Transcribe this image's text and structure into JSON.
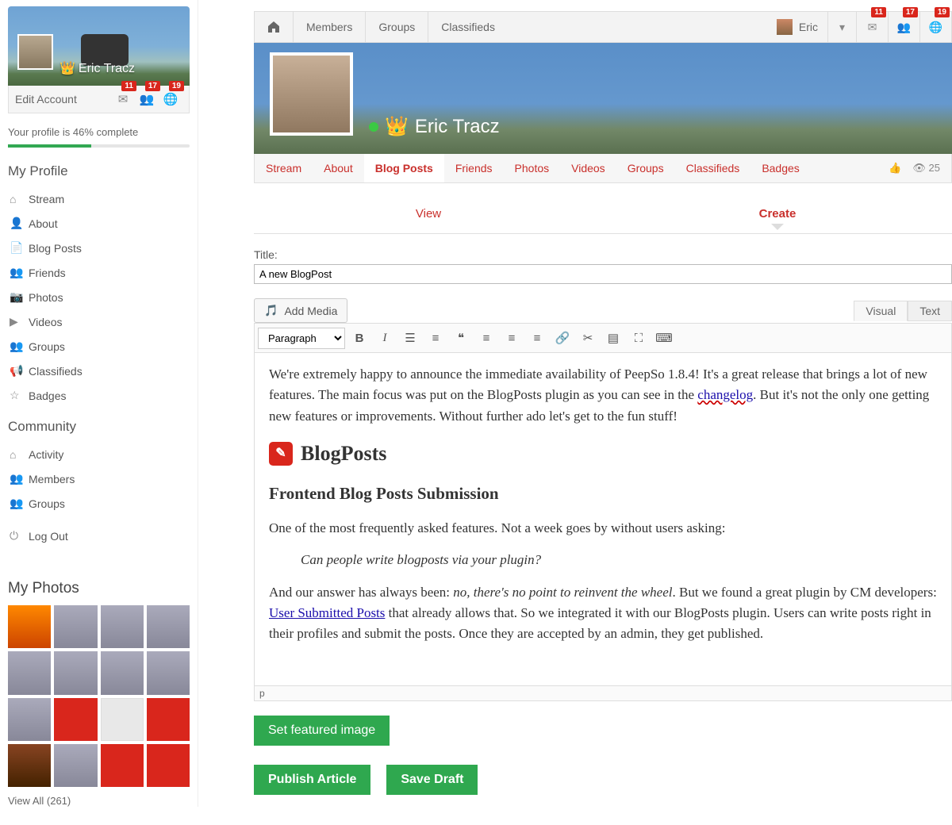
{
  "user": {
    "name": "Eric Tracz",
    "edit_label": "Edit Account"
  },
  "sidebar_badges": {
    "mail": "11",
    "friends": "17",
    "globe": "19"
  },
  "profile_progress": {
    "text": "Your profile is 46% complete",
    "percent": 46
  },
  "sections": {
    "my_profile": "My Profile",
    "community": "Community",
    "my_photos": "My Photos"
  },
  "nav_profile": [
    {
      "label": "Stream",
      "icon": "home"
    },
    {
      "label": "About",
      "icon": "user"
    },
    {
      "label": "Blog Posts",
      "icon": "file"
    },
    {
      "label": "Friends",
      "icon": "people"
    },
    {
      "label": "Photos",
      "icon": "camera"
    },
    {
      "label": "Videos",
      "icon": "play"
    },
    {
      "label": "Groups",
      "icon": "group"
    },
    {
      "label": "Classifieds",
      "icon": "bullhorn"
    },
    {
      "label": "Badges",
      "icon": "star"
    }
  ],
  "nav_community": [
    {
      "label": "Activity",
      "icon": "home"
    },
    {
      "label": "Members",
      "icon": "people"
    },
    {
      "label": "Groups",
      "icon": "group"
    }
  ],
  "logout": "Log Out",
  "view_all": "View All (261)",
  "topnav": {
    "members": "Members",
    "groups": "Groups",
    "classifieds": "Classifieds",
    "username": "Eric"
  },
  "top_badges": {
    "mail": "11",
    "friends": "17",
    "globe": "19"
  },
  "profile_tabs": [
    "Stream",
    "About",
    "Blog Posts",
    "Friends",
    "Photos",
    "Videos",
    "Groups",
    "Classifieds",
    "Badges"
  ],
  "profile_tabs_active": "Blog Posts",
  "views": "25",
  "subtabs": {
    "view": "View",
    "create": "Create"
  },
  "subtabs_active": "Create",
  "title_label": "Title:",
  "title_value": "A new BlogPost",
  "add_media": "Add Media",
  "editor_modes": {
    "visual": "Visual",
    "text": "Text"
  },
  "format_select": "Paragraph",
  "content": {
    "intro_a": "We're extremely happy to announce the immediate availability of PeepSo 1.8.4! It's a great release that brings a lot of new features. The main focus was put on the BlogPosts plugin as you can see in the ",
    "changelog": "changelog",
    "intro_b": ". But it's not the only one getting new features or improvements. Without further ado let's get to the fun stuff!",
    "h2": "BlogPosts",
    "h3": "Frontend Blog Posts Submission",
    "p2": "One of the most frequently asked features. Not a week goes by without users asking:",
    "quote": "Can people write blogposts via your plugin?",
    "p3_a": "And our answer has always been: ",
    "p3_em": "no, there's no point to reinvent the wheel",
    "p3_b": ". But we found a great plugin by CM developers: ",
    "usp": "User Submitted Posts",
    "p3_c": " that already allows that. So we integrated it with our BlogPosts plugin. Users can write posts right in their profiles and submit the posts. Once they are accepted by an admin, they get published."
  },
  "path": "p",
  "buttons": {
    "featured": "Set featured image",
    "publish": "Publish Article",
    "draft": "Save Draft"
  }
}
